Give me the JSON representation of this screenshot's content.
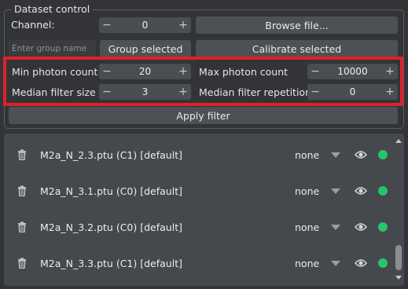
{
  "group_title": "Dataset control",
  "channel": {
    "label": "Channel:",
    "value": "0"
  },
  "browse_label": "Browse file...",
  "group_name_placeholder": "Enter group name",
  "group_selected_label": "Group selected",
  "calibrate_label": "Calibrate selected",
  "min_photon": {
    "label": "Min photon count",
    "value": "20"
  },
  "max_photon": {
    "label": "Max photon count",
    "value": "10000"
  },
  "median_size": {
    "label": "Median filter size",
    "value": "3"
  },
  "median_rep": {
    "label": "Median filter repetition",
    "value": "0"
  },
  "apply_label": "Apply filter",
  "spin_minus": "−",
  "spin_plus": "+",
  "datasets": [
    {
      "name": "M2a_N_2.3.ptu (C1) [default]",
      "mode": "none"
    },
    {
      "name": "M2a_N_3.1.ptu (C0) [default]",
      "mode": "none"
    },
    {
      "name": "M2a_N_3.2.ptu (C0) [default]",
      "mode": "none"
    },
    {
      "name": "M2a_N_3.3.ptu (C1) [default]",
      "mode": "none"
    }
  ],
  "colors": {
    "highlight": "#e0202a",
    "status_dot": "#27c46a"
  },
  "icons": {
    "delete": "trash-icon",
    "dropdown": "dropdown-arrow-icon",
    "visibility": "eye-icon",
    "status": "status-dot-icon"
  }
}
